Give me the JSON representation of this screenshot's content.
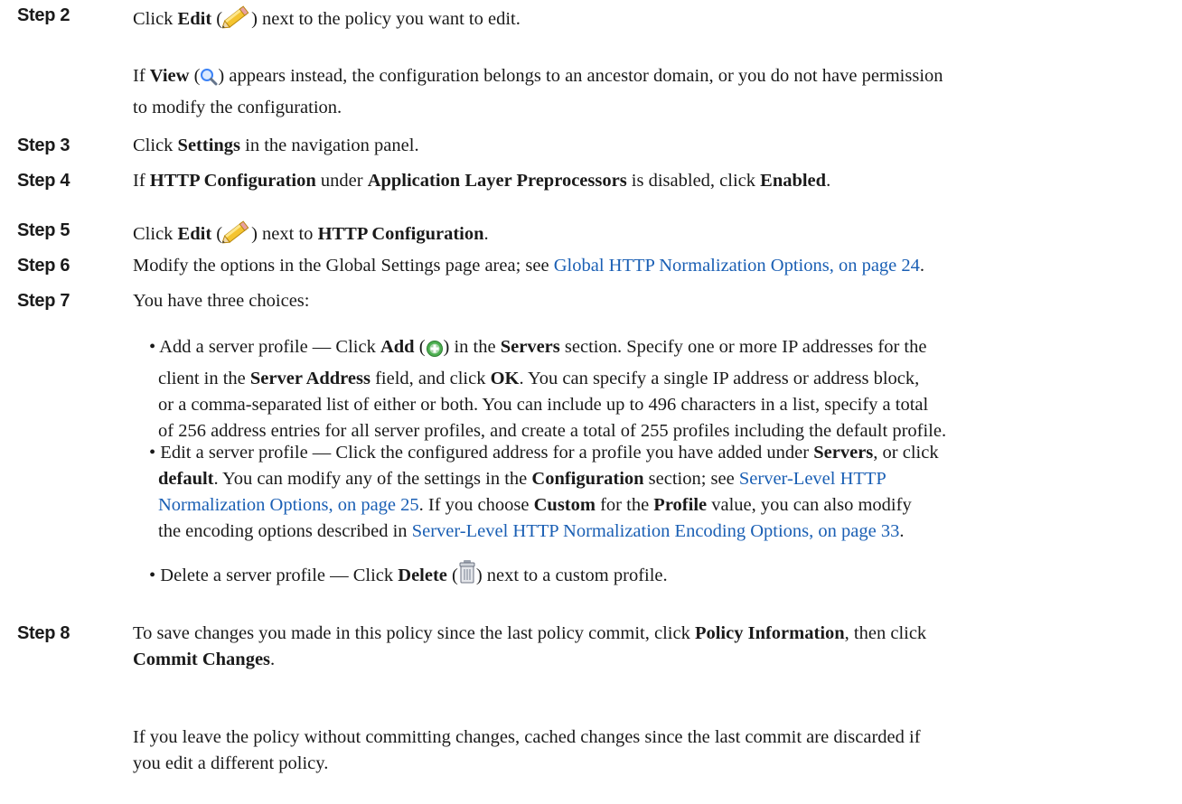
{
  "steps": {
    "s2": {
      "label": "Step 2",
      "t1": "Click ",
      "b1": "Edit",
      "t2": " (",
      "icon": "pencil-edit-icon",
      "t3": ") next to the policy you want to edit.",
      "note": {
        "b1": "View",
        "t1": " (",
        "icon": "magnifier-view-icon",
        "t2": ") appears instead, the configuration belongs to an ancestor domain, or you do not have permission",
        "pre": "If ",
        "line2": "to modify the configuration."
      }
    },
    "s3": {
      "label": "Step 3",
      "t1": "Click ",
      "b1": "Settings",
      "t2": " in the navigation panel."
    },
    "s4": {
      "label": "Step 4",
      "t1": "If ",
      "b1": "HTTP Configuration",
      "t2": " under ",
      "b2": "Application Layer Preprocessors",
      "t3": " is disabled, click ",
      "b3": "Enabled",
      "t4": "."
    },
    "s5": {
      "label": "Step 5",
      "t1": "Click ",
      "b1": "Edit",
      "t2": " (",
      "icon": "pencil-edit-icon",
      "t3": ") next to ",
      "b2": "HTTP Configuration",
      "t4": "."
    },
    "s6": {
      "label": "Step 6",
      "t1": "Modify the options in the Global Settings page area; see ",
      "link": "Global HTTP Normalization Options, on page 24",
      "t2": "."
    },
    "s7": {
      "label": "Step 7",
      "t1": "You have three choices:",
      "bullet1": {
        "t1": "• Add a server profile — Click ",
        "b1": "Add",
        "t2": " (",
        "icon": "add-plus-icon",
        "t3": ") in the ",
        "b2": "Servers",
        "t4": " section. Specify one or more IP addresses for the",
        "l2a": "client in the ",
        "l2b": "Server Address",
        "l2c": " field, and click ",
        "l2d": "OK",
        "l2e": ". You can specify a single IP address or address block,",
        "l3": "or a comma-separated list of either or both. You can include up to 496 characters in a list, specify a total",
        "l4": "of 256 address entries for all server profiles, and create a total of 255 profiles including the default profile."
      },
      "bullet2": {
        "t1": "• Edit a server profile — Click the configured address for a profile you have added under ",
        "b1": "Servers",
        "t2": ", or click",
        "l2a": "default",
        "l2b": ". You can modify any of the settings in the ",
        "l2c": "Configuration",
        "l2d": " section; see ",
        "l2link": "Server-Level HTTP",
        "l3link": "Normalization Options, on page 25",
        "l3a": ". If you choose ",
        "l3b": "Custom",
        "l3c": " for the ",
        "l3d": "Profile",
        "l3e": " value, you can also modify",
        "l4a": "the encoding options described in ",
        "l4link": "Server-Level HTTP Normalization Encoding Options, on page 33",
        "l4b": "."
      },
      "bullet3": {
        "t1": "• Delete a server profile — Click ",
        "b1": "Delete",
        "t2": " (",
        "icon": "trash-delete-icon",
        "t3": ") next to a custom profile."
      }
    },
    "s8": {
      "label": "Step 8",
      "t1": "To save changes you made in this policy since the last policy commit, click ",
      "b1": "Policy Information",
      "t2": ", then click",
      "b2": "Commit Changes",
      "t3": ".",
      "note1": "If you leave the policy without committing changes, cached changes since the last commit are discarded if",
      "note2": "you edit a different policy."
    }
  }
}
